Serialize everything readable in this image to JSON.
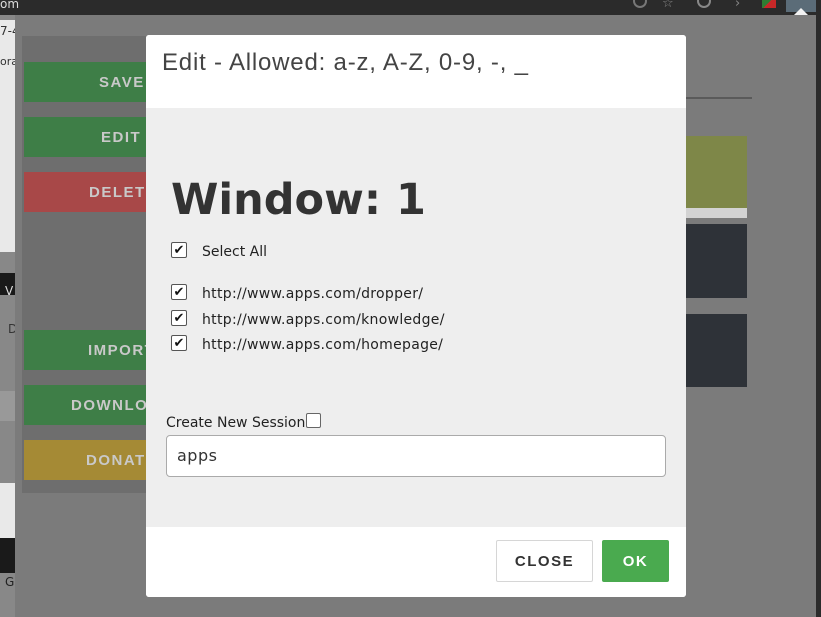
{
  "browser": {
    "url_fragment": "om",
    "left_fragments": [
      "7-4",
      "orac",
      "V",
      "D",
      "G"
    ],
    "icons": [
      "history-icon",
      "star-icon",
      "reload-icon",
      "forward-icon",
      "extension-icon",
      "session-buddy-icon"
    ]
  },
  "side_panel": {
    "buttons": [
      {
        "label": "SAVE",
        "color": "#3e7e47"
      },
      {
        "label": "EDIT",
        "color": "#3e7e47"
      },
      {
        "label": "DELETE",
        "color": "#a84848"
      },
      {
        "label": "IMPORT",
        "color": "#3e7e47"
      },
      {
        "label": "DOWNLOAD",
        "color": "#3e7e47"
      },
      {
        "label": "DONATE",
        "color": "#a58a35"
      }
    ]
  },
  "modal": {
    "title": "Edit - Allowed: a-z, A-Z, 0-9, -, _",
    "window_title": "Window: 1",
    "select_all": {
      "label": "Select All",
      "checked": true
    },
    "urls": [
      {
        "url": "http://www.apps.com/dropper/",
        "checked": true
      },
      {
        "url": "http://www.apps.com/knowledge/",
        "checked": true
      },
      {
        "url": "http://www.apps.com/homepage/",
        "checked": true
      }
    ],
    "create_new_session": {
      "label": "Create New Session",
      "checked": false
    },
    "session_name_value": "apps",
    "close_label": "CLOSE",
    "ok_label": "OK"
  },
  "colors": {
    "ok_button": "#4aaa4f",
    "overlay": "#7b7b7b",
    "modal_body": "#eeeeee"
  }
}
